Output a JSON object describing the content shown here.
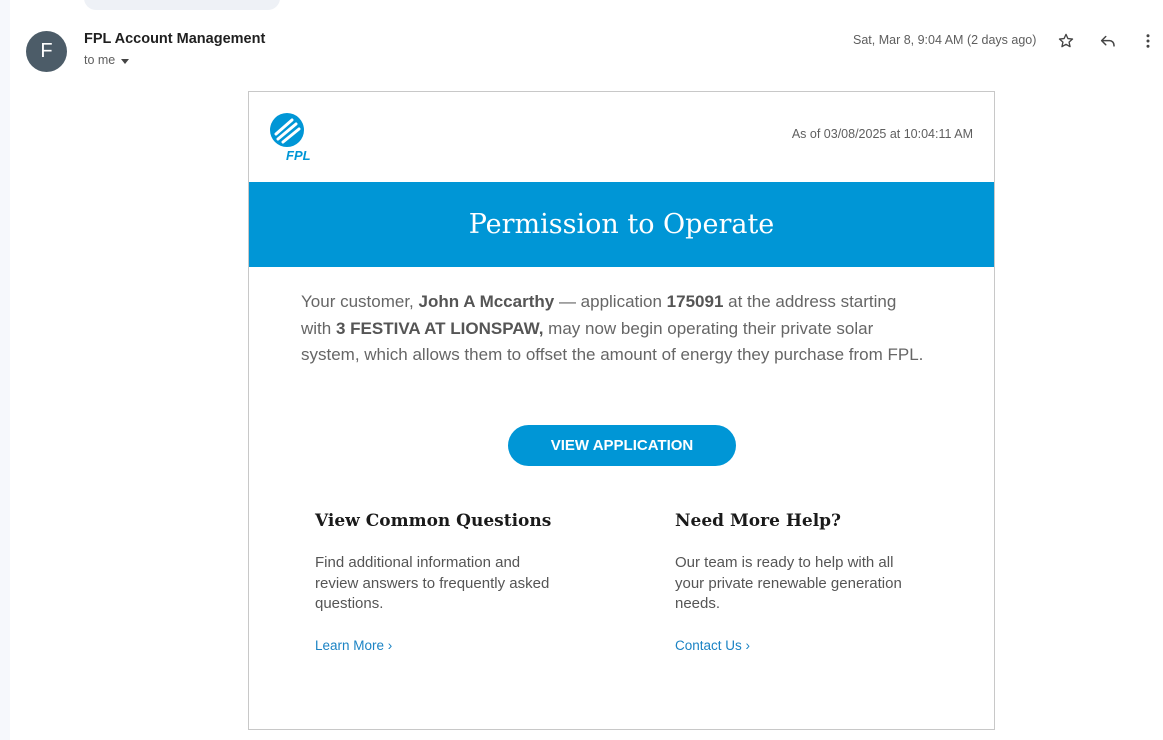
{
  "email": {
    "avatar_letter": "F",
    "sender_name": "FPL Account Management",
    "recipient_label": "to me",
    "date_text": "Sat, Mar 8, 9:04 AM (2 days ago)"
  },
  "icons": {
    "star": "star-icon",
    "reply": "reply-icon",
    "more": "more-vert-icon",
    "dropdown": "caret-down-icon",
    "logo": "fpl-logo"
  },
  "message": {
    "logo_text": "FPL",
    "as_of": "As of 03/08/2025 at 10:04:11 AM",
    "banner_title": "Permission to Operate",
    "body": {
      "part1": "Your customer, ",
      "customer_name": "John A Mccarthy",
      "part2": " — application ",
      "application_number": "175091",
      "part3": " at the address starting with ",
      "address": "3 FESTIVA AT LIONSPAW,",
      "part4": " may now begin operating their private solar system, which allows them to offset the amount of energy they purchase from FPL."
    },
    "cta_label": "VIEW APPLICATION",
    "columns": [
      {
        "title": "View Common Questions",
        "text": "Find additional information and review answers to frequently asked questions.",
        "link": "Learn More  ›"
      },
      {
        "title": "Need More Help?",
        "text": "Our team is ready to help with all your private renewable generation needs.",
        "link": "Contact Us  ›"
      }
    ]
  },
  "colors": {
    "brand_blue": "#0096d6",
    "link_blue": "#1b83c4",
    "avatar_bg": "#4c5c68"
  }
}
